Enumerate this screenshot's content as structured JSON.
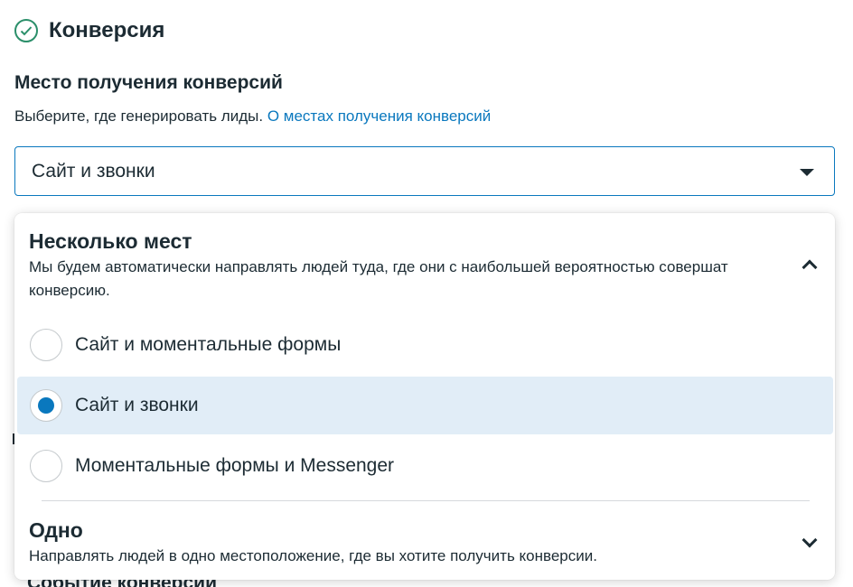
{
  "section": {
    "title": "Конверсия",
    "icon": "check-circle-icon"
  },
  "field": {
    "label": "Место получения конверсий",
    "help_text": "Выберите, где генерировать лиды.",
    "help_link": "О местах получения конверсий",
    "selected_value": "Сайт и звонки"
  },
  "dropdown": {
    "multi": {
      "title": "Несколько мест",
      "description": "Мы будем автоматически направлять людей туда, где они с наибольшей вероятностью совершат конверсию.",
      "expanded": true,
      "options": [
        {
          "label": "Сайт и моментальные формы",
          "selected": false
        },
        {
          "label": "Сайт и звонки",
          "selected": true
        },
        {
          "label": "Моментальные формы и Messenger",
          "selected": false
        }
      ]
    },
    "single": {
      "title": "Одно",
      "description": "Направлять людей в одно местоположение, где вы хотите получить конверсии.",
      "expanded": false
    }
  },
  "background_peek": "Событие конверсии",
  "colors": {
    "accent": "#0a78be",
    "selected_bg": "#e1edf7",
    "check": "#2b8f6a",
    "text": "#1c2b33"
  }
}
